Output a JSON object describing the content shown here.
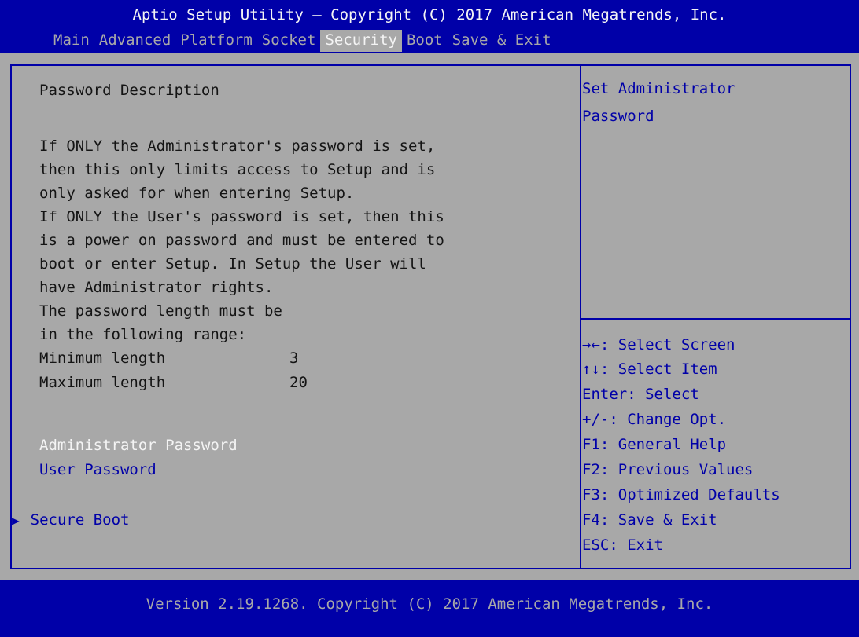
{
  "header": {
    "title": "Aptio Setup Utility – Copyright (C) 2017 American Megatrends, Inc.",
    "tabs": [
      "Main",
      "Advanced",
      "Platform",
      "Socket",
      "Security",
      "Boot",
      "Save & Exit"
    ],
    "active_tab": "Security"
  },
  "main": {
    "heading": "Password Description",
    "description": [
      "If ONLY the Administrator's password is set,",
      "then this only limits access to Setup and is",
      "only asked for when entering Setup.",
      "If ONLY the User's password is set, then this",
      "is a power on password and must be entered to",
      "boot or enter Setup. In Setup the User will",
      "have Administrator rights.",
      "The password length must be",
      "in the following range:"
    ],
    "min_label": "Minimum length",
    "min_value": "3",
    "max_label": "Maximum length",
    "max_value": "20",
    "items": [
      "Administrator Password",
      "User Password"
    ],
    "submenu": "Secure Boot"
  },
  "help": {
    "text": [
      "Set Administrator",
      "Password"
    ],
    "keys": [
      "→←: Select Screen",
      "↑↓: Select Item",
      "Enter: Select",
      "+/-: Change Opt.",
      "F1: General Help",
      "F2: Previous Values",
      "F3: Optimized Defaults",
      "F4: Save & Exit",
      "ESC: Exit"
    ]
  },
  "footer": {
    "version": "Version 2.19.1268. Copyright (C) 2017 American Megatrends, Inc."
  },
  "colors": {
    "bios_blue": "#0000a8",
    "panel_gray": "#a8a8a8",
    "highlight_white": "#f4f4f4"
  }
}
